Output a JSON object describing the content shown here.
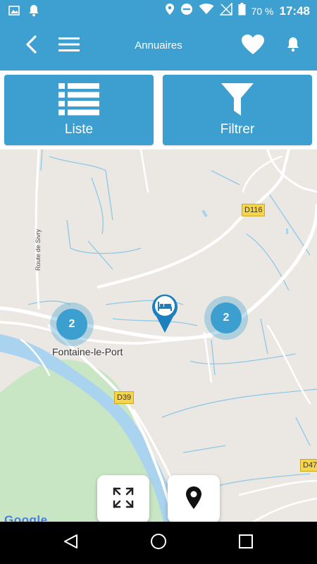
{
  "status_bar": {
    "battery": "70 %",
    "time": "17:48",
    "left_icons": [
      "image-icon",
      "notification-bell-icon"
    ],
    "right_icons": [
      "location-icon",
      "do-not-disturb-icon",
      "wifi-icon",
      "no-signal-icon",
      "battery-icon"
    ]
  },
  "app_bar": {
    "title": "Annuaires",
    "icons": [
      "back-arrow-icon",
      "hamburger-menu-icon",
      "heart-icon",
      "bell-icon"
    ]
  },
  "tabs": [
    {
      "label": "Liste",
      "icon": "list-icon"
    },
    {
      "label": "Filtrer",
      "icon": "filter-icon"
    }
  ],
  "map": {
    "roads": {
      "d116": "D116",
      "d39": "D39",
      "d47": "D47"
    },
    "place": "Fontaine-le-Port",
    "route": "Route de Sivry",
    "clusters": [
      {
        "count": "2"
      },
      {
        "count": "2"
      }
    ],
    "marker_icon": "hotel-bed-icon",
    "attribution": "Google",
    "controls": [
      "expand-icon",
      "location-pin-icon"
    ],
    "colors": {
      "water": "#a9d3ee",
      "forest": "#c8e6c4",
      "river": "#8fc7e6",
      "cluster": "#3d9fcf"
    }
  },
  "nav_bar": {
    "icons": [
      "nav-back-icon",
      "nav-home-icon",
      "nav-recent-icon"
    ]
  },
  "colors": {
    "primary": "#3ea0d0",
    "accent": "#3d9fcf"
  }
}
